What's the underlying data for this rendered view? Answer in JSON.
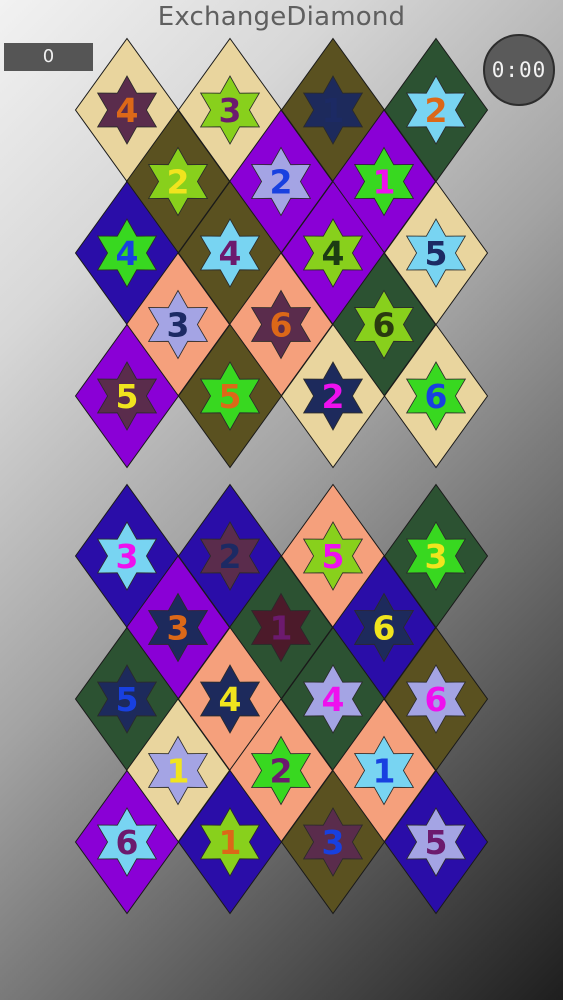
{
  "title": "ExchangeDiamond",
  "score": "0",
  "timer": "0:00",
  "colors": {
    "tan": "#e9d59e",
    "olive": "#5a5120",
    "forest": "#2c5232",
    "navy": "#2a0da8",
    "purple": "#8a00d6",
    "salmon": "#f5a07c",
    "lime": "#88d01c",
    "green": "#38d820",
    "sky": "#78d4f2",
    "lavender": "#a4a4e4",
    "darknavy": "#1d2a5c",
    "plum": "#5a2c4c",
    "magenta": "#ee10ee",
    "orange": "#dc6818",
    "yellow": "#f0e41e",
    "darkgreen": "#1c3c14",
    "darkblue": "#1c2a64",
    "maroon": "#4c1a2a",
    "darkpurple": "#6c1a6e",
    "blue": "#1840e0",
    "darkolive": "#2a3a10"
  },
  "boards": [
    {
      "name": "top",
      "rows": [
        [
          {
            "bg": "tan",
            "star": "plum",
            "num": "4",
            "numColor": "orange"
          },
          {
            "bg": "tan",
            "star": "lime",
            "num": "3",
            "numColor": "darkpurple"
          },
          {
            "bg": "olive",
            "star": "darknavy",
            "num": "1",
            "numColor": "darkblue"
          },
          {
            "bg": "forest",
            "star": "sky",
            "num": "2",
            "numColor": "orange"
          }
        ],
        [
          {
            "bg": "olive",
            "star": "lime",
            "num": "2",
            "numColor": "yellow"
          },
          {
            "bg": "purple",
            "star": "lavender",
            "num": "2",
            "numColor": "blue"
          },
          {
            "bg": "purple",
            "star": "green",
            "num": "1",
            "numColor": "magenta"
          }
        ],
        [
          {
            "bg": "navy",
            "star": "green",
            "num": "4",
            "numColor": "blue"
          },
          {
            "bg": "olive",
            "star": "sky",
            "num": "4",
            "numColor": "darkpurple"
          },
          {
            "bg": "purple",
            "star": "lime",
            "num": "4",
            "numColor": "darkgreen"
          },
          {
            "bg": "tan",
            "star": "sky",
            "num": "5",
            "numColor": "darkblue"
          }
        ],
        [
          {
            "bg": "salmon",
            "star": "lavender",
            "num": "3",
            "numColor": "darkblue"
          },
          {
            "bg": "salmon",
            "star": "plum",
            "num": "6",
            "numColor": "orange"
          },
          {
            "bg": "forest",
            "star": "lime",
            "num": "6",
            "numColor": "darkolive"
          }
        ],
        [
          {
            "bg": "purple",
            "star": "plum",
            "num": "5",
            "numColor": "yellow"
          },
          {
            "bg": "olive",
            "star": "green",
            "num": "5",
            "numColor": "orange"
          },
          {
            "bg": "tan",
            "star": "darknavy",
            "num": "2",
            "numColor": "magenta"
          },
          {
            "bg": "tan",
            "star": "green",
            "num": "6",
            "numColor": "blue"
          }
        ]
      ]
    },
    {
      "name": "bottom",
      "rows": [
        [
          {
            "bg": "navy",
            "star": "sky",
            "num": "3",
            "numColor": "magenta"
          },
          {
            "bg": "navy",
            "star": "plum",
            "num": "2",
            "numColor": "darkblue"
          },
          {
            "bg": "salmon",
            "star": "lime",
            "num": "5",
            "numColor": "magenta"
          },
          {
            "bg": "forest",
            "star": "green",
            "num": "3",
            "numColor": "yellow"
          }
        ],
        [
          {
            "bg": "purple",
            "star": "darknavy",
            "num": "3",
            "numColor": "orange"
          },
          {
            "bg": "forest",
            "star": "maroon",
            "num": "1",
            "numColor": "darkpurple"
          },
          {
            "bg": "navy",
            "star": "darknavy",
            "num": "6",
            "numColor": "yellow"
          }
        ],
        [
          {
            "bg": "forest",
            "star": "darknavy",
            "num": "5",
            "numColor": "blue"
          },
          {
            "bg": "salmon",
            "star": "darknavy",
            "num": "4",
            "numColor": "yellow"
          },
          {
            "bg": "forest",
            "star": "lavender",
            "num": "4",
            "numColor": "magenta"
          },
          {
            "bg": "olive",
            "star": "lavender",
            "num": "6",
            "numColor": "magenta"
          }
        ],
        [
          {
            "bg": "tan",
            "star": "lavender",
            "num": "1",
            "numColor": "yellow"
          },
          {
            "bg": "salmon",
            "star": "green",
            "num": "2",
            "numColor": "darkpurple"
          },
          {
            "bg": "salmon",
            "star": "sky",
            "num": "1",
            "numColor": "blue"
          }
        ],
        [
          {
            "bg": "purple",
            "star": "sky",
            "num": "6",
            "numColor": "darkpurple"
          },
          {
            "bg": "navy",
            "star": "lime",
            "num": "1",
            "numColor": "orange"
          },
          {
            "bg": "olive",
            "star": "plum",
            "num": "3",
            "numColor": "blue"
          },
          {
            "bg": "navy",
            "star": "lavender",
            "num": "5",
            "numColor": "darkpurple"
          }
        ]
      ]
    }
  ]
}
